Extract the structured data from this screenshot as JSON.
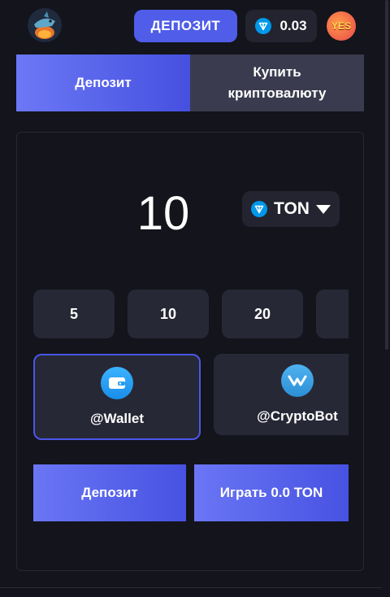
{
  "header": {
    "logo_icon": "shark-logo-icon",
    "deposit_button_label": "ДЕПОЗИТ",
    "balance": {
      "icon": "ton-icon",
      "value": "0.03"
    },
    "avatar_text": "YES"
  },
  "tabs": [
    {
      "label": "Депозит",
      "active": true
    },
    {
      "label": "Купить\nкриптовалюту",
      "active": false
    }
  ],
  "deposit_form": {
    "amount": "10",
    "currency": {
      "icon": "ton-icon",
      "label": "TON"
    },
    "presets": [
      "5",
      "10",
      "20",
      ""
    ],
    "methods": [
      {
        "icon": "wallet-icon",
        "label": "@Wallet",
        "selected": true
      },
      {
        "icon": "cryptobot-icon",
        "label": "@CryptoBot",
        "selected": false
      }
    ],
    "deposit_button_label": "Депозит",
    "play_button_label": "Играть 0.0 TON"
  },
  "colors": {
    "background": "#13141c",
    "accent": "#4f5de8",
    "panel": "#272836",
    "ton_blue": "#0098ea"
  }
}
